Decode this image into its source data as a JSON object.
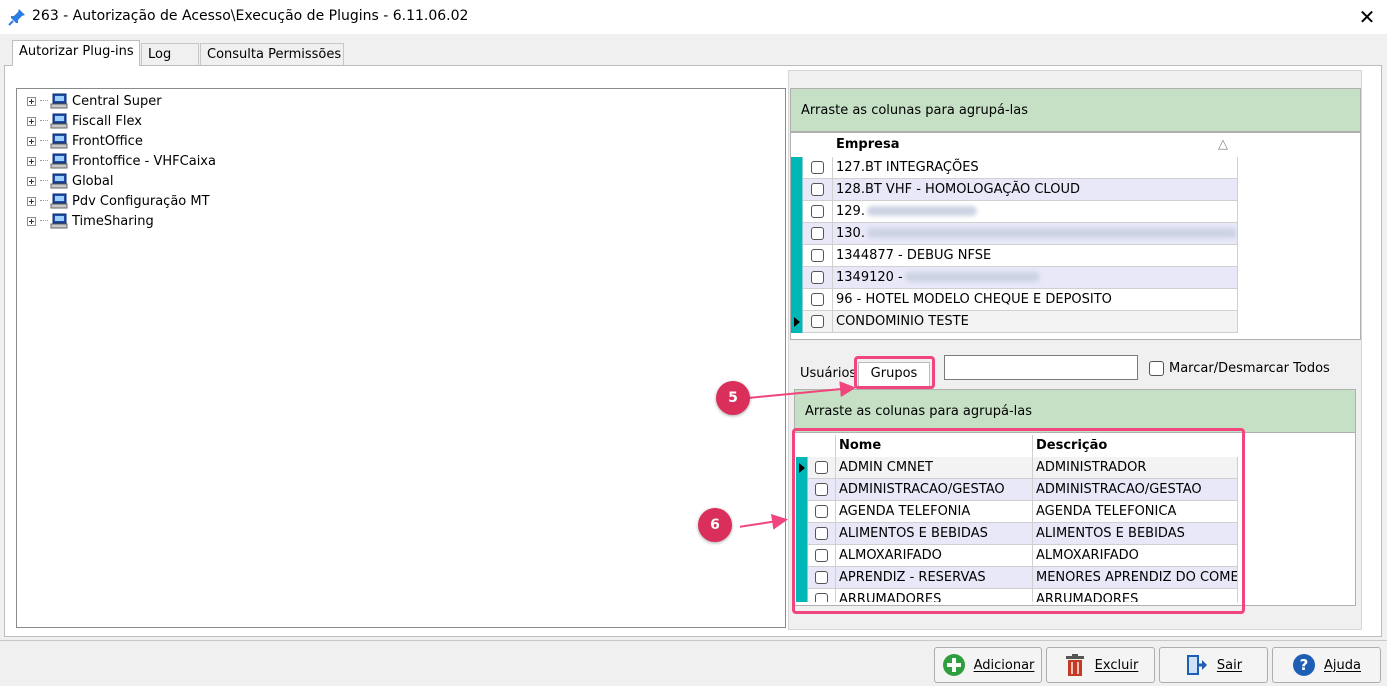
{
  "window": {
    "title": "263 - Autorização de Acesso\\Execução de Plugins - 6.11.06.02",
    "close_glyph": "✕"
  },
  "tabs": [
    {
      "label": "Autorizar Plug-ins",
      "active": true
    },
    {
      "label": "Log",
      "active": false
    },
    {
      "label": "Consulta Permissões",
      "active": false
    }
  ],
  "tree": {
    "items": [
      {
        "label": "Central Super",
        "icon": "computer-icon"
      },
      {
        "label": "Fiscall Flex",
        "icon": "computer-icon"
      },
      {
        "label": "FrontOffice",
        "icon": "computer-icon"
      },
      {
        "label": "Frontoffice - VHFCaixa",
        "icon": "computer-icon"
      },
      {
        "label": "Global",
        "icon": "computer-icon"
      },
      {
        "label": "Pdv Configuração MT",
        "icon": "computer-icon"
      },
      {
        "label": "TimeSharing",
        "icon": "computer-icon"
      }
    ]
  },
  "empresa_grid": {
    "group_hint": "Arraste as colunas para agrupá-las",
    "column": "Empresa",
    "sort_glyph": "△",
    "rows": [
      {
        "text": "127.BT INTEGRAÇÕES",
        "blurred": false
      },
      {
        "text": "128.BT VHF - HOMOLOGAÇÃO CLOUD",
        "blurred": false
      },
      {
        "text": "129.",
        "blurred": true
      },
      {
        "text": "130.",
        "blurred": true
      },
      {
        "text": "1344877 - DEBUG NFSE",
        "blurred": false
      },
      {
        "text": "1349120 -",
        "blurred": true
      },
      {
        "text": "96 - HOTEL MODELO CHEQUE E DEPOSITO",
        "blurred": false
      },
      {
        "text": "CONDOMINIO TESTE",
        "blurred": false
      }
    ]
  },
  "subtabs": [
    {
      "label": "Usuários",
      "active": false
    },
    {
      "label": "Grupos",
      "active": true
    }
  ],
  "search": {
    "value": "",
    "placeholder": ""
  },
  "toggle_all_label": "Marcar/Desmarcar Todos",
  "grupos_grid": {
    "group_hint": "Arraste as colunas para agrupá-las",
    "columns": [
      "Nome",
      "Descrição"
    ],
    "rows": [
      {
        "nome": "ADMIN CMNET",
        "descricao": "ADMINISTRADOR"
      },
      {
        "nome": "ADMINISTRACAO/GESTAO",
        "descricao": "ADMINISTRACAO/GESTAO"
      },
      {
        "nome": "AGENDA TELEFONIA",
        "descricao": "AGENDA TELEFONICA"
      },
      {
        "nome": "ALIMENTOS E BEBIDAS",
        "descricao": "ALIMENTOS E BEBIDAS"
      },
      {
        "nome": "ALMOXARIFADO",
        "descricao": "ALMOXARIFADO"
      },
      {
        "nome": "APRENDIZ - RESERVAS",
        "descricao": "MENORES APRENDIZ DO COME"
      },
      {
        "nome": "ARRUMADORES",
        "descricao": "ARRUMADORES"
      }
    ]
  },
  "callouts": [
    "5",
    "6"
  ],
  "buttons": [
    {
      "label": "Adicionar",
      "icon": "add-icon",
      "color": "#2e9e3e"
    },
    {
      "label": "Excluir",
      "icon": "trash-icon",
      "color": "#c23b22"
    },
    {
      "label": "Sair",
      "icon": "exit-icon",
      "color": "#1d5fb5"
    },
    {
      "label": "Ajuda",
      "icon": "help-icon",
      "color": "#1d5fb5"
    }
  ],
  "colors": {
    "accent_teal": "#00b7b7",
    "group_header_green": "#c5e0c4",
    "highlight_pink": "#f0457d",
    "callout_red": "#d92f5a"
  }
}
